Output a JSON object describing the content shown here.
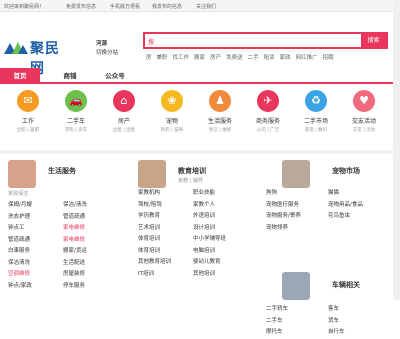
{
  "topbar": {
    "welcome": "欢迎来到聚民网！",
    "publish": "免费发布信息",
    "mobile": "手机版方便看",
    "my_publish": "我发布的信息",
    "follow": "关注我们"
  },
  "header": {
    "logo_text": "聚民网",
    "city": "河源",
    "switch_city": "切换分站",
    "search_placeholder": "搜",
    "search_button": "搜索",
    "hotlinks": [
      "房",
      "兼职",
      "找工作",
      "搬家",
      "房产",
      "免费送",
      "二手",
      "租赁",
      "家政",
      "网红推广",
      "招聘"
    ]
  },
  "nav": {
    "tabs": [
      "首页",
      "商铺",
      "公众号"
    ]
  },
  "categories": [
    {
      "name": "工作",
      "sub": "全职 | 兼职",
      "icon": "briefcase-icon",
      "color": "#f59b23",
      "glyph": "✉"
    },
    {
      "name": "二手车",
      "sub": "求购 | 卖车",
      "icon": "car-icon",
      "color": "#6cc14d",
      "glyph": "🚗"
    },
    {
      "name": "房产",
      "sub": "出租 | 出售",
      "icon": "house-icon",
      "color": "#e8365d",
      "glyph": "⌂"
    },
    {
      "name": "宠物",
      "sub": "狗狗 | 猫咪",
      "icon": "paw-icon",
      "color": "#f5b820",
      "glyph": "❀"
    },
    {
      "name": "生活服务",
      "sub": "保洁 | 维修",
      "icon": "service-icon",
      "color": "#f08a3c",
      "glyph": "♟"
    },
    {
      "name": "商务服务",
      "sub": "公司 | 广告",
      "icon": "business-icon",
      "color": "#e8365d",
      "glyph": "✈"
    },
    {
      "name": "二手市场",
      "sub": "家电 | 数码",
      "icon": "market-icon",
      "color": "#3aa3e3",
      "glyph": "♻"
    },
    {
      "name": "交友活动",
      "sub": "交友 | 活动",
      "icon": "heart-icon",
      "color": "#f06a7e",
      "glyph": "♥"
    }
  ],
  "sections": {
    "life": {
      "title": "生活服务",
      "sub": "家政保洁",
      "items": [
        [
          "保姆/月嫂",
          "保洁/清洗"
        ],
        [
          "洗衣护理",
          "管道疏通"
        ],
        [
          "钟点工",
          "家电维修"
        ],
        [
          "管道疏通",
          "家电维修"
        ],
        [
          "白事服务",
          "搬家/货运"
        ],
        [
          "保洁清洗",
          "生活配送"
        ],
        [
          "空调维修",
          "房屋装修"
        ],
        [
          "钟点/家政",
          "停车服务"
        ]
      ]
    },
    "edu": {
      "title": "教育培训",
      "sub": "家教 | 辅导",
      "items": [
        [
          "家教机构",
          "职业技能"
        ],
        [
          "驾校/陪驾",
          "家教个人"
        ],
        [
          "学历教育",
          "外语培训"
        ],
        [
          "艺术培训",
          "设计培训"
        ],
        [
          "体育培训",
          "中小学辅导班"
        ],
        [
          "体育培训",
          "电脑培训"
        ],
        [
          "其他教育培训",
          "婴幼儿教育"
        ],
        [
          "IT培训",
          "其他培训"
        ]
      ]
    },
    "pet": {
      "title": "宠物市场",
      "items": [
        [
          "狗狗",
          "猫猫"
        ],
        [
          "宠物医疗服务",
          "宠物用品/食品"
        ],
        [
          "宠物服务/寄养",
          "花鸟鱼虫"
        ],
        [
          "宠物领养",
          ""
        ]
      ]
    },
    "car": {
      "title": "车辆相关",
      "items": [
        [
          "二手轿车",
          "客车"
        ],
        [
          "二手车",
          "货车"
        ],
        [
          "摩托车",
          "自行车"
        ]
      ]
    }
  }
}
